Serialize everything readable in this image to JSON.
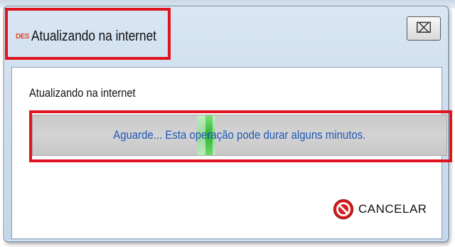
{
  "window": {
    "app_logo_text": "DES",
    "title": "Atualizando na internet",
    "close_glyph": "⌧"
  },
  "content": {
    "status_label": "Atualizando na internet",
    "progress": {
      "message": "Aguarde... Esta operação pode durar alguns minutos.",
      "state": "indeterminate",
      "marquee_position_fraction": 0.42,
      "fill_color": "#2bb52b",
      "track_color": "#cccccc"
    },
    "cancel_button": {
      "label": "CANCELAR",
      "icon": "stop-icon",
      "icon_color": "#d81e1e"
    }
  },
  "annotations": {
    "highlight_color": "#e0141e"
  }
}
